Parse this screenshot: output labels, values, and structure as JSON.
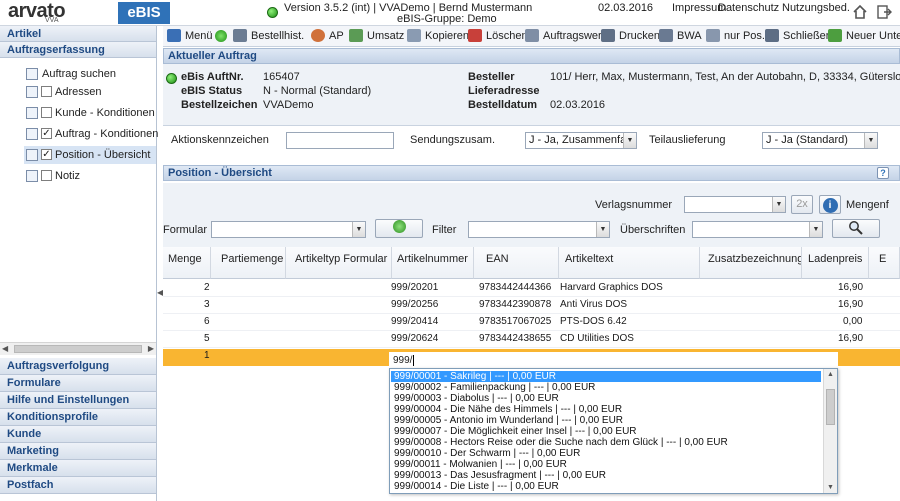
{
  "header": {
    "brand": "arvato",
    "brand_sub": "VVA",
    "product": "eBIS",
    "version_line": "Version 3.5.2 (int) | VVADemo | Bernd Mustermann",
    "group_line": "eBIS-Gruppe: Demo",
    "date": "02.03.2016",
    "links": [
      "Impressum",
      "Datenschutz",
      "Nutzungsbed."
    ],
    "icons": [
      "home-icon",
      "logout-icon"
    ]
  },
  "sidebar": {
    "top_sections": [
      "Artikel",
      "Auftragserfassung"
    ],
    "items": [
      {
        "label": "Auftrag suchen",
        "checkbox": false,
        "checked": false,
        "selected": false
      },
      {
        "label": "Adressen",
        "checkbox": true,
        "checked": false,
        "selected": false
      },
      {
        "label": "Kunde - Konditionen",
        "checkbox": true,
        "checked": false,
        "selected": false
      },
      {
        "label": "Auftrag - Konditionen",
        "checkbox": true,
        "checked": true,
        "selected": false
      },
      {
        "label": "Position - Übersicht",
        "checkbox": true,
        "checked": true,
        "selected": true
      },
      {
        "label": "Notiz",
        "checkbox": true,
        "checked": false,
        "selected": false
      }
    ],
    "bottom_sections": [
      "Auftragsverfolgung",
      "Formulare",
      "Hilfe und Einstellungen",
      "Konditionsprofile",
      "Kunde",
      "Marketing",
      "Merkmale",
      "Postfach"
    ]
  },
  "toolbar": {
    "items": [
      "Menü",
      "Bestellhist.",
      "AP",
      "Umsatz",
      "Kopieren",
      "Löschen",
      "Auftragswert",
      "Drucken",
      "BWA",
      "nur Pos.",
      "Schließen",
      "Neuer Untera"
    ]
  },
  "current_order": {
    "title": "Aktueller Auftrag",
    "labels": {
      "order_no": "eBis AuftNr.",
      "status": "eBIS Status",
      "reference": "Bestellzeichen",
      "orderer": "Besteller",
      "delivery": "Lieferadresse",
      "order_date": "Bestelldatum"
    },
    "values": {
      "order_no": "165407",
      "status": "N - Normal (Standard)",
      "reference": "VVADemo",
      "orderer": "101/ Herr, Max, Mustermann, Test, An der Autobahn, D, 33334, Gütersloh",
      "delivery": "",
      "order_date": "02.03.2016"
    }
  },
  "form": {
    "action_label": "Aktionskennzeichen",
    "action_value": "",
    "shipment_label": "Sendungszusam.",
    "shipment_value": "J - Ja, Zusammenfass",
    "partial_label": "Teilauslieferung",
    "partial_value": "J - Ja (Standard)"
  },
  "positions": {
    "title": "Position - Übersicht",
    "help": "?",
    "publisher_label": "Verlagsnummer",
    "publisher_value": "",
    "btn_2x": "2x",
    "quantity_label": "Mengenf",
    "formular_label": "Formular",
    "filter_label": "Filter",
    "headings_label": "Überschriften"
  },
  "table": {
    "columns": [
      "Menge",
      "Partiemenge",
      "Artikeltyp Formular",
      "Artikelnummer",
      "EAN",
      "Artikeltext",
      "Zusatzbezeichnung",
      "Ladenpreis",
      "E"
    ],
    "rows": [
      {
        "menge": "2",
        "nr": "999/20201",
        "ean": "9783442444366",
        "text": "Harvard Graphics DOS",
        "preis": "16,90"
      },
      {
        "menge": "3",
        "nr": "999/20256",
        "ean": "9783442390878",
        "text": "Anti Virus DOS",
        "preis": "16,90"
      },
      {
        "menge": "6",
        "nr": "999/20414",
        "ean": "9783517067025",
        "text": "PTS-DOS 6.42",
        "preis": "0,00"
      },
      {
        "menge": "5",
        "nr": "999/20624",
        "ean": "9783442438655",
        "text": "CD Utilities DOS",
        "preis": "16,90"
      }
    ],
    "active_row": {
      "menge": "1",
      "input": "999/"
    }
  },
  "dropdown": {
    "items": [
      "999/00001 - Sakrileg | --- | 0,00 EUR",
      "999/00002 - Familienpackung | --- | 0,00 EUR",
      "999/00003 - Diabolus | --- | 0,00 EUR",
      "999/00004 - Die Nähe des Himmels | --- | 0,00 EUR",
      "999/00005 - Antonio im Wunderland | --- | 0,00 EUR",
      "999/00007 - Die Möglichkeit einer Insel | --- | 0,00 EUR",
      "999/00008 - Hectors Reise oder die Suche nach dem Glück | --- | 0,00 EUR",
      "999/00010 - Der Schwarm | --- | 0,00 EUR",
      "999/00011 - Molwanien | --- | 0,00 EUR",
      "999/00013 - Das Jesusfragment | --- | 0,00 EUR",
      "999/00014 - Die Liste | --- | 0,00 EUR"
    ]
  }
}
